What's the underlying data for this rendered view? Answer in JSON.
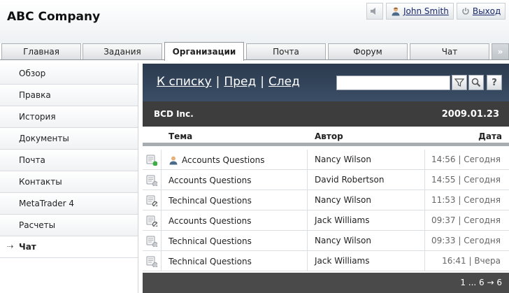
{
  "header": {
    "company": "ABC Company",
    "user_name": "John Smith",
    "logout_label": "Выход"
  },
  "tabs": [
    {
      "label": "Главная"
    },
    {
      "label": "Задания"
    },
    {
      "label": "Организации",
      "active": true
    },
    {
      "label": "Почта"
    },
    {
      "label": "Форум"
    },
    {
      "label": "Чат"
    }
  ],
  "tabs_more": "»",
  "sidebar": {
    "items": [
      {
        "label": "Обзор"
      },
      {
        "label": "Правка"
      },
      {
        "label": "История"
      },
      {
        "label": "Документы"
      },
      {
        "label": "Почта"
      },
      {
        "label": "Контакты"
      },
      {
        "label": "MetaTrader 4"
      },
      {
        "label": "Расчеты"
      },
      {
        "label": "Чат",
        "active": true
      }
    ],
    "active_marker": "⇢"
  },
  "nav": {
    "to_list": "К списку",
    "prev": "Пред",
    "next": "След",
    "separator": "|",
    "search_value": "",
    "help_label": "?"
  },
  "org": {
    "name": "BCD Inc.",
    "date": "2009.01.23"
  },
  "table": {
    "headers": {
      "topic": "Тема",
      "author": "Автор",
      "date": "Дата"
    },
    "rows": [
      {
        "topic": "Accounts Questions",
        "author": "Nancy Wilson",
        "time": "14:56 | Сегодня",
        "status": "online",
        "has_user_icon": true
      },
      {
        "topic": "Accounts Questions",
        "author": "David Robertson",
        "time": "14:55 | Сегодня",
        "status": "offline",
        "has_user_icon": false
      },
      {
        "topic": "Techincal Questions",
        "author": "Nancy Wilson",
        "time": "11:53 | Сегодня",
        "status": "closed",
        "has_user_icon": false
      },
      {
        "topic": "Accounts Questions",
        "author": "Jack Williams",
        "time": "09:37 | Сегодня",
        "status": "closed",
        "has_user_icon": false
      },
      {
        "topic": "Technical Questions",
        "author": "Nancy Wilson",
        "time": "09:33 | Сегодня",
        "status": "offline",
        "has_user_icon": false
      },
      {
        "topic": "Technical Questions",
        "author": "Jack Williams",
        "time": "16:41 | Вчера",
        "status": "offline",
        "has_user_icon": false
      }
    ]
  },
  "pager": {
    "text": "1 ... 6 → 6"
  },
  "colors": {
    "nav_bg": "#2b3a4e",
    "org_bar": "#3d3d3d",
    "link": "#1a2a6c",
    "status_online": "#3cb043",
    "status_closed": "#555555"
  },
  "icons": {
    "sound": "speaker-icon",
    "user": "user-icon",
    "logout": "power-icon",
    "filter": "funnel-icon",
    "search": "magnifier-icon",
    "help": "help-icon"
  }
}
